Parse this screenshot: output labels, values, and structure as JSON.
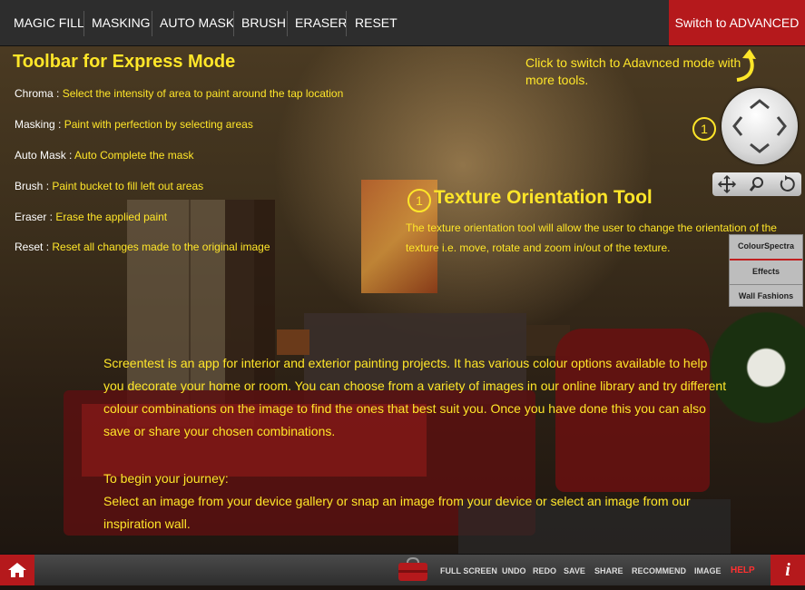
{
  "toolbar": {
    "items": [
      "MAGIC FILL",
      "MASKING",
      "AUTO MASK",
      "BRUSH",
      "ERASER",
      "RESET"
    ],
    "advanced_label": "Switch to ADVANCED"
  },
  "express": {
    "heading": "Toolbar for Express Mode",
    "rows": [
      {
        "key": "Chroma",
        "sep": " : ",
        "value": "Select the intensity of area to paint around the tap location"
      },
      {
        "key": "Masking",
        "sep": " : ",
        "value": "Paint with perfection by selecting areas"
      },
      {
        "key": "Auto Mask",
        "sep": " : ",
        "value": "Auto Complete the mask"
      },
      {
        "key": "Brush",
        "sep": " : ",
        "value": "Paint bucket to fill left out areas"
      },
      {
        "key": "Eraser",
        "sep": " : ",
        "value": "Erase the applied paint"
      },
      {
        "key": "Reset",
        "sep": " : ",
        "value": "Reset all changes made to the original image"
      }
    ]
  },
  "advanced_note": "Click to switch to Adavnced mode with more tools.",
  "texture": {
    "number": "1",
    "title": "Texture Orientation Tool",
    "description": "The texture orientation tool will allow the user to change the orientation of the texture i.e. move, rotate and zoom in/out of the texture."
  },
  "dpad_number": "1",
  "side_menu": [
    "ColourSpectra",
    "Effects",
    "Wall Fashions"
  ],
  "description": "Screentest is an app for interior and exterior painting projects. It has various colour options available to help you decorate your home or room. You can choose from a variety of images in our online library and try different colour combinations on the image to find the ones that best suit you. Once you have done this you can also save or share your chosen combinations.",
  "begin": {
    "title": "To begin your journey:",
    "text": "Select an image from your device gallery or snap an image from your device or select an image from our inspiration wall."
  },
  "bottom": {
    "items": [
      "FULL SCREEN",
      "UNDO",
      "REDO",
      "SAVE",
      "SHARE",
      "RECOMMEND",
      "IMAGE"
    ],
    "help": "HELP"
  },
  "colors": {
    "accent_red": "#b5191c",
    "highlight_yellow": "#ffe629",
    "toolbar_bg": "#2d2d2d"
  },
  "icons": [
    "home-icon",
    "info-icon",
    "paint-bag-icon",
    "move-icon",
    "zoom-icon",
    "rotate-icon",
    "curved-arrow-icon",
    "direction-pad-icon"
  ]
}
